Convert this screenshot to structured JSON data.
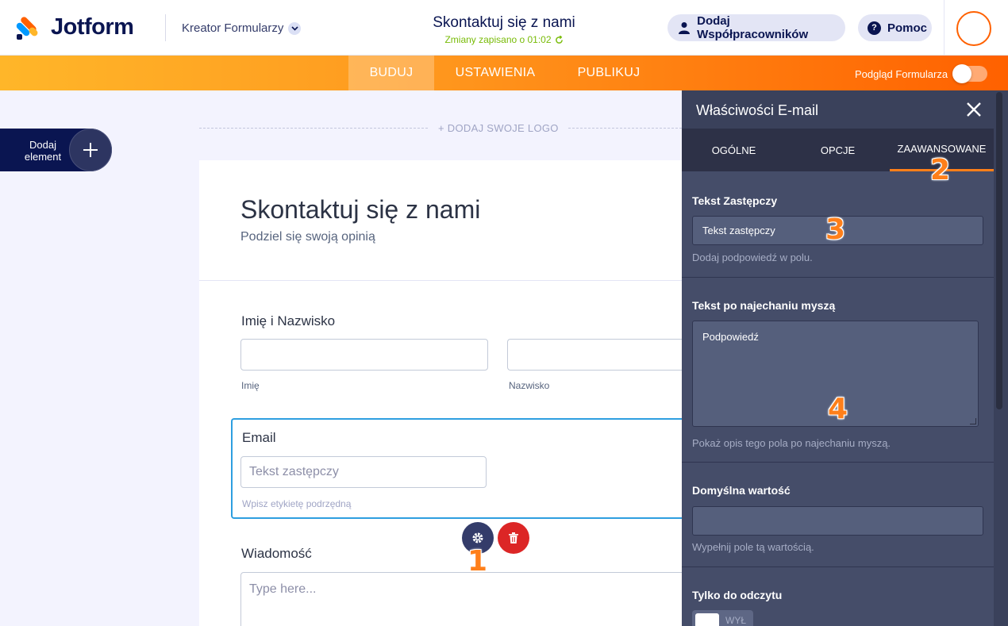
{
  "header": {
    "brand": "Jotform",
    "builder_label": "Kreator Formularzy",
    "form_title": "Skontaktuj się z nami",
    "save_status": "Zmiany zapisano o 01:02",
    "collaborators_button": "Dodaj Współpracowników",
    "help_button": "Pomoc"
  },
  "nav": {
    "tabs": [
      "BUDUJ",
      "USTAWIENIA",
      "PUBLIKUJ"
    ],
    "active_tab": "BUDUJ",
    "preview_label": "Podgląd Formularza",
    "preview_enabled": false
  },
  "canvas": {
    "add_element_label": "Dodaj element",
    "add_logo_label": "+ DODAJ SWOJE LOGO"
  },
  "form": {
    "title": "Skontaktuj się z nami",
    "subtitle": "Podziel się swoją opinią",
    "name_field": {
      "label": "Imię i Nazwisko",
      "first_sublabel": "Imię",
      "last_sublabel": "Nazwisko"
    },
    "email_field": {
      "label": "Email",
      "placeholder": "Tekst zastępczy",
      "sublabel": "Wpisz etykietę podrzędną"
    },
    "message_field": {
      "label": "Wiadomość",
      "placeholder": "Type here..."
    }
  },
  "panel": {
    "title": "Właściwości E-mail",
    "tabs": [
      "OGÓLNE",
      "OPCJE",
      "ZAAWANSOWANE"
    ],
    "active_tab": "ZAAWANSOWANE",
    "placeholder_section": {
      "label": "Tekst Zastępczy",
      "value": "Tekst zastępczy",
      "hint": "Dodaj podpowiedź w polu."
    },
    "hover_section": {
      "label": "Tekst po najechaniu myszą",
      "value": "Podpowiedź",
      "hint": "Pokaż opis tego pola po najechaniu myszą."
    },
    "default_section": {
      "label": "Domyślna wartość",
      "value": "",
      "hint": "Wypełnij pole tą wartością."
    },
    "readonly_section": {
      "label": "Tylko do odczytu",
      "toggle_text": "WYŁ"
    }
  },
  "markers": [
    "1",
    "2",
    "3",
    "4"
  ],
  "colors": {
    "brand_orange": "#ff6100",
    "brand_navy": "#0a1551",
    "focus_blue": "#2e9fe0",
    "delete_red": "#dc2626",
    "saved_green": "#78bb07"
  }
}
